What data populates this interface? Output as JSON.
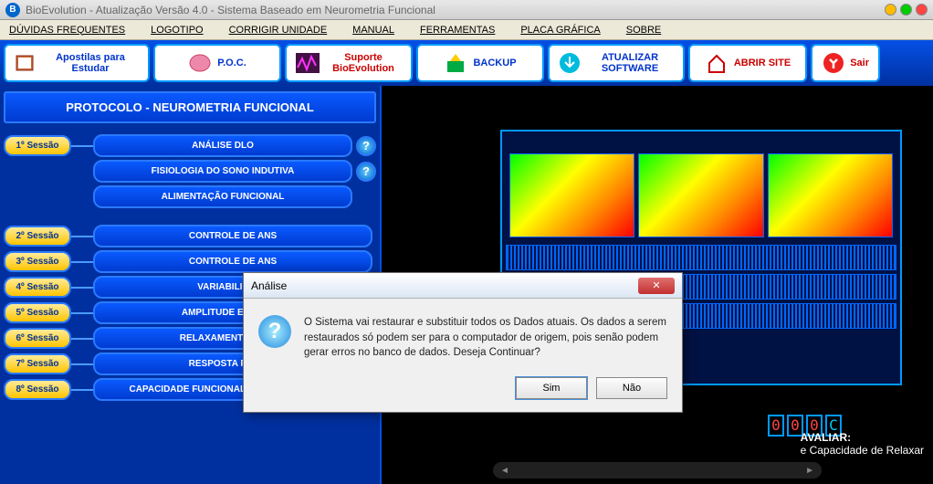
{
  "titlebar": {
    "icon_letter": "B",
    "text": "BioEvolution - Atualização Versão 4.0  -  Sistema Baseado em Neurometria Funcional"
  },
  "menubar": [
    "DÚVIDAS FREQUENTES",
    "LOGOTIPO",
    "CORRIGIR UNIDADE",
    "MANUAL",
    "FERRAMENTAS",
    "PLACA GRÁFICA",
    "SOBRE"
  ],
  "toolbar": {
    "apostilas": "Apostilas para Estudar",
    "poc": "P.O.C.",
    "suporte": "Suporte BioEvolution",
    "backup": "BACKUP",
    "atualizar": "ATUALIZAR SOFTWARE",
    "abrir": "ABRIR SITE",
    "sair": "Sair"
  },
  "panel_title": "PROTOCOLO - NEUROMETRIA FUNCIONAL",
  "sessions": {
    "s1": {
      "label": "1º Sessão",
      "items": [
        "ANÁLISE  DLO",
        "FISIOLOGIA DO SONO INDUTIVA",
        "ALIMENTAÇÃO FUNCIONAL"
      ]
    },
    "s2": {
      "label": "2º Sessão",
      "item": "CONTROLE DE ANS"
    },
    "s3": {
      "label": "3º Sessão",
      "item": "CONTROLE DE ANS"
    },
    "s4": {
      "label": "4º Sessão",
      "item": "VARIABILIDADE"
    },
    "s5": {
      "label": "5º Sessão",
      "item": "AMPLITUDE E FREQUÊ"
    },
    "s6": {
      "label": "6º Sessão",
      "item": "RELAXAMENTO MUSCU"
    },
    "s7": {
      "label": "7º Sessão",
      "item": "RESPOSTA FISIOLÓ"
    },
    "s8": {
      "label": "8º Sessão",
      "item": "CAPACIDADE FUNCIONAL RESPIRATÓRIA"
    }
  },
  "help_label": "?",
  "right_box": {
    "avaliar": "AVALIAR:",
    "sub": "e Capacidade de Relaxar"
  },
  "digits": [
    "0",
    "0",
    "0"
  ],
  "digits_unit": "C",
  "dialog": {
    "title": "Análise",
    "message": "O Sistema vai restaurar e substituir todos os Dados atuais. Os dados a serem restaurados só podem ser para o computador de origem, pois senão podem gerar erros no banco de dados. Deseja Continuar?",
    "yes": "Sim",
    "no": "Não",
    "close": "✕"
  }
}
